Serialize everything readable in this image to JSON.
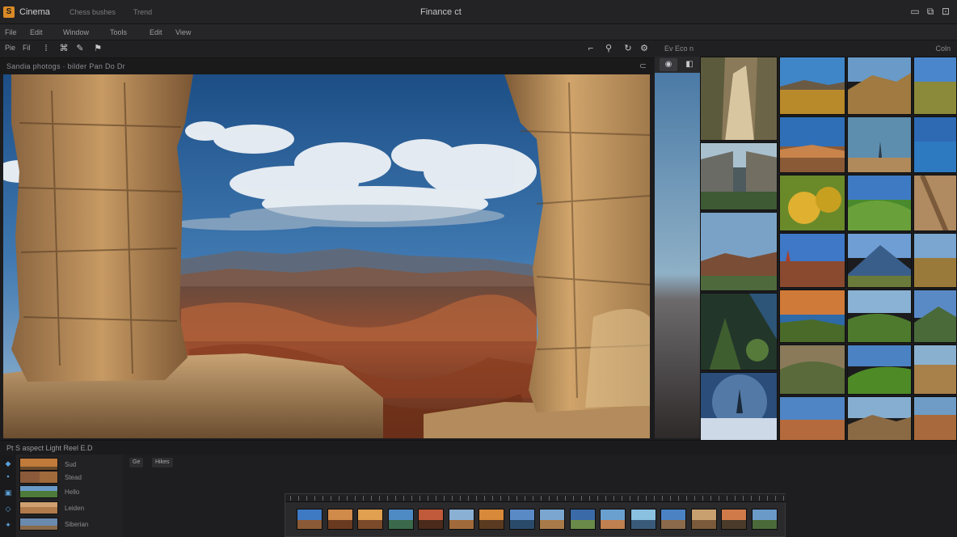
{
  "titlebar": {
    "app_logo": "S",
    "app_name": "Cinema",
    "items": [
      "Chess bushes",
      "Trend"
    ],
    "window_title": "Finance ct",
    "controls": [
      "minimize-icon",
      "maximize-icon",
      "close-icon"
    ]
  },
  "menu": {
    "items": [
      "File",
      "Edit",
      "Window",
      "Tools",
      "Edit",
      "View"
    ]
  },
  "toolbar": {
    "buttons": [
      "Pie",
      "Fil"
    ],
    "icons": [
      "crop-icon",
      "pin-icon",
      "rotate-icon",
      "settings-icon"
    ]
  },
  "path": {
    "text": "Sandia photogs · bilder Pan  Do Dr"
  },
  "right_panel": {
    "tabs": "Ev  Eco  n",
    "right_label": "Coln"
  },
  "status": {
    "text": "Pt   S  aspect Light Reel  E.D"
  },
  "bottom": {
    "list_items": [
      "Sud",
      "Stead",
      "Hello",
      "Leiden",
      "Siberian"
    ],
    "filters": [
      "Ge",
      "Hikes"
    ]
  },
  "colors": {
    "accent": "#d98a26",
    "blue": "#5aa0d8",
    "bg": "#1c1c1e"
  }
}
